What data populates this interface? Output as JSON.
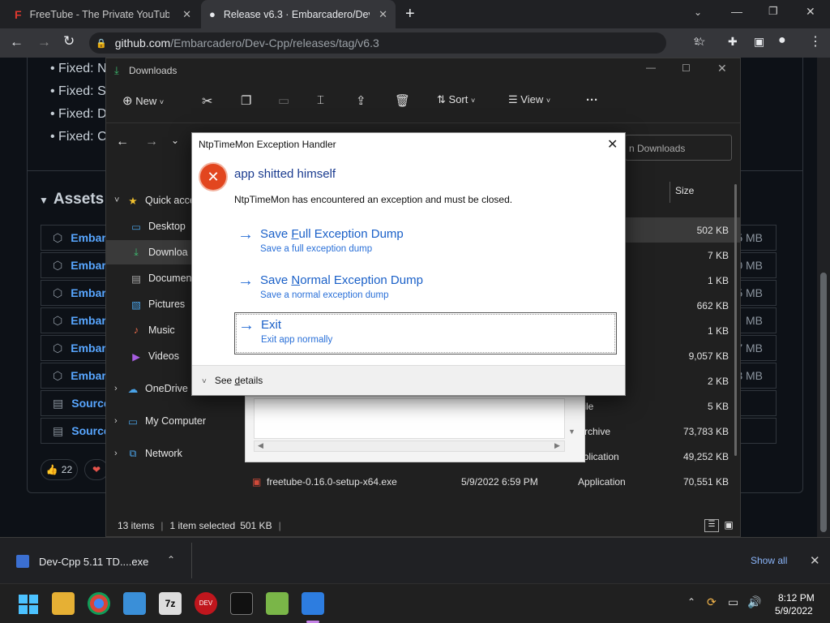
{
  "browser": {
    "tabs": [
      {
        "title": "FreeTube - The Private YouTube",
        "active": false
      },
      {
        "title": "Release v6.3 · Embarcadero/Dev-",
        "active": true
      }
    ],
    "url_domain": "github.com",
    "url_path": "/Embarcadero/Dev-Cpp/releases/tag/v6.3"
  },
  "page": {
    "bullets": [
      "Fixed: N",
      "Fixed: S",
      "Fixed: D",
      "Fixed: C"
    ],
    "assets_heading": "Assets",
    "assets": [
      {
        "name": "Embar",
        "size": "5 MB",
        "icon": "package-icon"
      },
      {
        "name": "Embar",
        "size": "0 MB",
        "icon": "package-icon"
      },
      {
        "name": "Embar",
        "size": "5 MB",
        "icon": "package-icon"
      },
      {
        "name": "Embar",
        "size": "MB",
        "icon": "package-icon"
      },
      {
        "name": "Embar",
        "size": "7 MB",
        "icon": "package-icon"
      },
      {
        "name": "Embar",
        "size": "3 MB",
        "icon": "package-icon"
      },
      {
        "name": "Source",
        "size": "",
        "icon": "file-zip-icon"
      },
      {
        "name": "Source",
        "size": "",
        "icon": "file-zip-icon"
      }
    ],
    "reactions": [
      {
        "emoji": "👍",
        "count": "22"
      },
      {
        "emoji": "❤",
        "count": ""
      }
    ]
  },
  "explorer": {
    "title": "Downloads",
    "toolbar": {
      "new": "New",
      "sort": "Sort",
      "view": "View"
    },
    "search_placeholder": "n Downloads",
    "column_size": "Size",
    "nav": [
      {
        "label": "Quick acce",
        "icon": "star-icon"
      },
      {
        "label": "Desktop",
        "icon": "desktop-icon"
      },
      {
        "label": "Downloa",
        "icon": "download-icon"
      },
      {
        "label": "Documen",
        "icon": "document-icon"
      },
      {
        "label": "Pictures",
        "icon": "pictures-icon"
      },
      {
        "label": "Music",
        "icon": "music-icon"
      },
      {
        "label": "Videos",
        "icon": "videos-icon"
      },
      {
        "label": "OneDrive",
        "icon": "cloud-icon"
      },
      {
        "label": "My Computer",
        "icon": "computer-icon"
      },
      {
        "label": "Network",
        "icon": "network-icon"
      }
    ],
    "files": [
      {
        "name": "",
        "date": "",
        "type": "",
        "size": "502 KB"
      },
      {
        "name": "",
        "date": "",
        "type": "",
        "size": "7 KB"
      },
      {
        "name": "",
        "date": "",
        "type": "",
        "size": "1 KB"
      },
      {
        "name": "",
        "date": "",
        "type": "",
        "size": "662 KB"
      },
      {
        "name": "",
        "date": "",
        "type": "",
        "size": "1 KB"
      },
      {
        "name": "",
        "date": "",
        "type": "",
        "size": "9,057 KB"
      },
      {
        "name": "",
        "date": "",
        "type": "",
        "size": "2 KB"
      },
      {
        "name": "",
        "date": "",
        "type": "File",
        "size": "5 KB"
      },
      {
        "name": "",
        "date": "",
        "type": "Archive",
        "size": "73,783 KB"
      },
      {
        "name": "",
        "date": "",
        "type": "pplication",
        "size": "49,252 KB"
      },
      {
        "name": "freetube-0.16.0-setup-x64.exe",
        "date": "5/9/2022 6:59 PM",
        "type": "Application",
        "size": "70,551 KB"
      }
    ],
    "status": {
      "items": "13 items",
      "selected": "1 item selected",
      "sel_size": "501 KB"
    }
  },
  "dialog": {
    "title": "NtpTimeMon Exception Handler",
    "main_instruction": "app shitted himself",
    "content": "NtpTimeMon has encountered an exception and must be closed.",
    "commands": [
      {
        "pre": "Save ",
        "u": "F",
        "post": "ull Exception Dump",
        "note": "Save a full exception dump"
      },
      {
        "pre": "Save ",
        "u": "N",
        "post": "ormal Exception Dump",
        "note": "Save a normal exception dump"
      },
      {
        "pre": "Exit",
        "u": "",
        "post": "",
        "note": "Exit app normally"
      }
    ],
    "see_details_pre": "See ",
    "see_details_u": "d",
    "see_details_post": "etails"
  },
  "download_bar": {
    "file": "Dev-Cpp 5.11 TD....exe",
    "show_all": "Show all"
  },
  "taskbar": {
    "time": "8:12 PM",
    "date": "5/9/2022"
  }
}
